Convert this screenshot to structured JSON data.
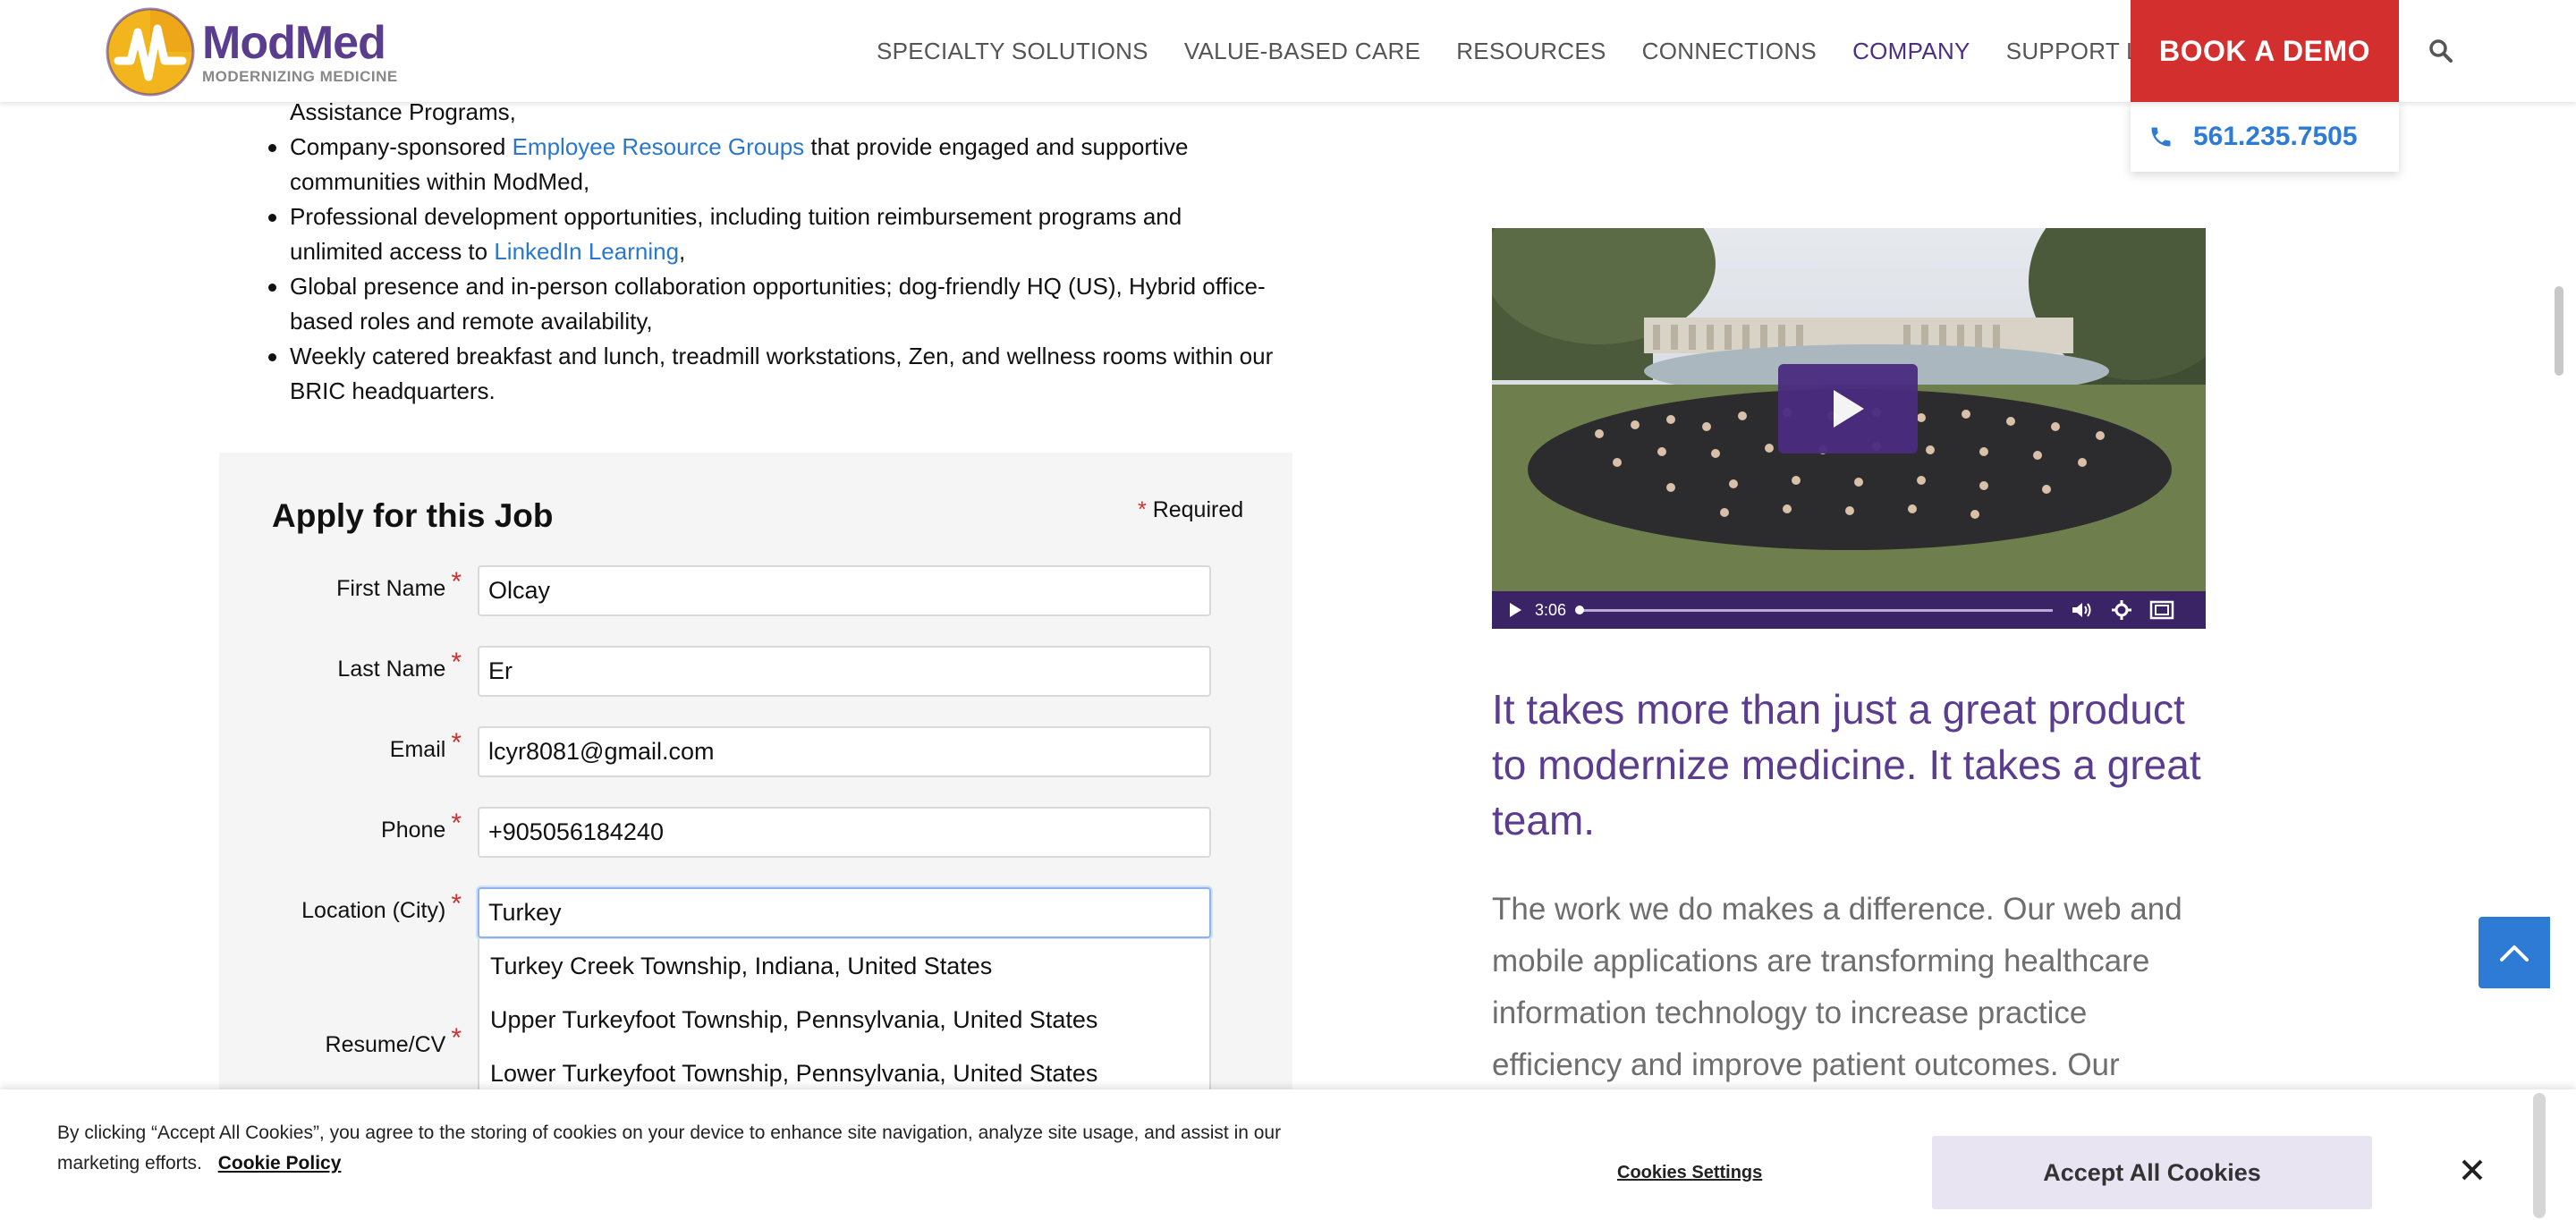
{
  "header": {
    "logo_name": "ModMed",
    "logo_tagline": "MODERNIZING MEDICINE",
    "nav": [
      {
        "label": "SPECIALTY SOLUTIONS"
      },
      {
        "label": "VALUE-BASED CARE"
      },
      {
        "label": "RESOURCES"
      },
      {
        "label": "CONNECTIONS"
      },
      {
        "label": "COMPANY"
      },
      {
        "label": "SUPPORT LOGIN"
      }
    ],
    "book_demo": "BOOK A DEMO",
    "phone": "561.235.7505"
  },
  "benefits": {
    "line0": "Assistance Programs,",
    "items": [
      {
        "pre": "Company-sponsored ",
        "link": "Employee Resource Groups",
        "post": " that provide engaged and supportive",
        "line2": "communities within ModMed,"
      },
      {
        "pre": "Professional development opportunities, including tuition reimbursement programs and",
        "line2_pre": "unlimited access to ",
        "link": "LinkedIn Learning",
        "line2_post": ","
      },
      {
        "line1": "Global presence and in-person collaboration opportunities; dog-friendly HQ (US), Hybrid office-",
        "line2": "based roles and remote availability,"
      },
      {
        "line1": "Weekly catered breakfast and lunch, treadmill workstations, Zen, and wellness rooms within our",
        "line2": "BRIC headquarters."
      }
    ]
  },
  "form": {
    "title": "Apply for this Job",
    "required_star": "*",
    "required_label": "Required",
    "fields": [
      {
        "label": "First Name",
        "value": "Olcay"
      },
      {
        "label": "Last Name",
        "value": "Er"
      },
      {
        "label": "Email",
        "value": "lcyr8081@gmail.com"
      },
      {
        "label": "Phone",
        "value": "+905056184240"
      },
      {
        "label": "Location (City)",
        "value": "Turkey"
      },
      {
        "label": "Resume/CV"
      }
    ],
    "suggestions": [
      "Turkey Creek Township, Indiana, United States",
      "Upper Turkeyfoot Township, Pennsylvania, United States",
      "Lower Turkeyfoot Township, Pennsylvania, United States"
    ]
  },
  "video": {
    "time": "3:06",
    "progress": 0.0
  },
  "right": {
    "tagline": "It takes more than just a great product to modernize medicine. It takes a great team.",
    "body": "The work we do makes a difference. Our web and mobile applications are transforming healthcare information technology to increase practice efficiency and improve patient outcomes. Our innovative and"
  },
  "cookie": {
    "text": "By clicking “Accept All Cookies”, you agree to the storing of cookies on your device to enhance site navigation, analyze site usage, and assist in our marketing efforts.",
    "policy_link": "Cookie Policy",
    "settings": "Cookies Settings",
    "accept": "Accept All Cookies"
  },
  "colors": {
    "brand_purple": "#5a3d8e",
    "demo_red": "#d32f2f",
    "link_blue": "#2a77d0"
  }
}
